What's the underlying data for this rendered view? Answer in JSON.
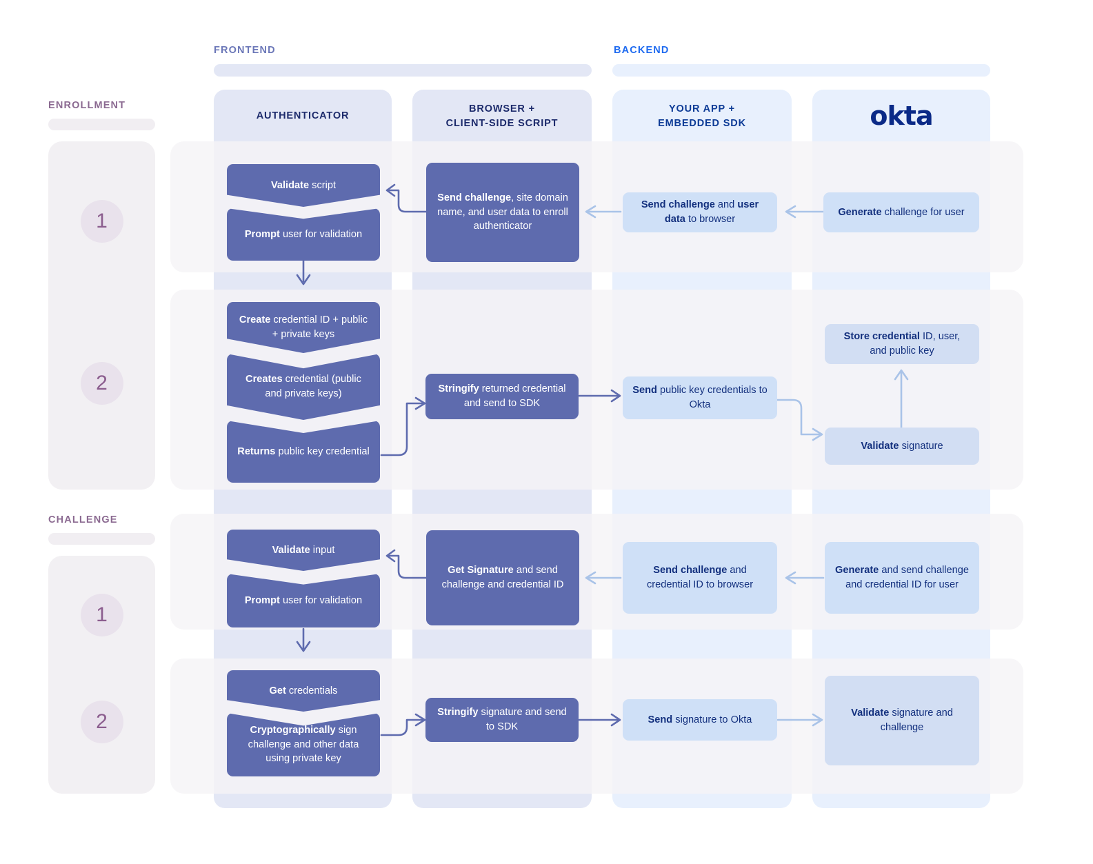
{
  "sections": {
    "frontend_label": "FRONTEND",
    "backend_label": "BACKEND",
    "enrollment_label": "ENROLLMENT",
    "challenge_label": "CHALLENGE"
  },
  "lanes": [
    {
      "id": "authenticator",
      "title": "AUTHENTICATOR"
    },
    {
      "id": "browser",
      "title_line1": "BROWSER +",
      "title_line2": "CLIENT-SIDE SCRIPT"
    },
    {
      "id": "yourapp",
      "title_line1": "YOUR APP +",
      "title_line2": "EMBEDDED SDK"
    },
    {
      "id": "okta",
      "title": "okta"
    }
  ],
  "steps": {
    "enrollment": [
      {
        "number": "1"
      },
      {
        "number": "2"
      }
    ],
    "challenge": [
      {
        "number": "1"
      },
      {
        "number": "2"
      }
    ]
  },
  "nodes": {
    "e1_validate_script": {
      "bold": "Validate",
      "rest": " script"
    },
    "e1_prompt_user": {
      "bold": "Prompt",
      "rest": " user for validation"
    },
    "e1_send_challenge_site": {
      "bold": "Send challenge",
      "rest": ", site domain name, and user data to enroll authenticator"
    },
    "e1_send_challenge_user": {
      "bold": "Send challenge",
      "mid": " and ",
      "bold2": "user data",
      "rest": " to browser"
    },
    "e1_generate": {
      "bold": "Generate",
      "rest": " challenge for user"
    },
    "e2_create_cred": {
      "bold": "Create",
      "rest": " credential ID + public + private keys"
    },
    "e2_creates_cred": {
      "bold": "Creates",
      "rest": " credential (public and private keys)"
    },
    "e2_returns_pubkey": {
      "bold": "Returns",
      "rest": " public key credential"
    },
    "e2_stringify": {
      "bold": "Stringify",
      "rest": " returned credential and send to SDK"
    },
    "e2_send_pubkey": {
      "bold": "Send",
      "rest": " public key credentials to Okta"
    },
    "e2_validate_sig": {
      "bold": "Validate",
      "rest": " signature"
    },
    "e2_store_cred": {
      "bold": "Store credential",
      "rest": " ID, user, and public key"
    },
    "c1_validate_input": {
      "bold": "Validate",
      "rest": " input"
    },
    "c1_prompt_user": {
      "bold": "Prompt",
      "rest": " user for validation"
    },
    "c1_get_signature": {
      "bold": "Get Signature",
      "rest": " and send challenge and credential ID"
    },
    "c1_send_challenge": {
      "bold": "Send challenge",
      "rest": " and credential ID to browser"
    },
    "c1_generate": {
      "bold": "Generate",
      "rest": " and send challenge and credential ID for user"
    },
    "c2_get_credentials": {
      "bold": "Get",
      "rest": " credentials"
    },
    "c2_crypto_sign": {
      "bold": "Cryptographically",
      "rest": " sign challenge and other data using private key"
    },
    "c2_stringify_sig": {
      "bold": "Stringify",
      "rest": " signature and send to SDK"
    },
    "c2_send_sig": {
      "bold": "Send",
      "rest": " signature to Okta"
    },
    "c2_validate": {
      "bold": "Validate",
      "rest": " signature and challenge"
    }
  },
  "colors": {
    "dark_node": "#5e6bae",
    "light_node": "#cfe0f7",
    "frontend_lane": "#e3e7f5",
    "backend_lane": "#e8f0fd",
    "frontend_label": "#6b77b8",
    "backend_label": "#1f6bf0",
    "side_label": "#8b6a91",
    "okta_blue": "#0b2a87"
  }
}
